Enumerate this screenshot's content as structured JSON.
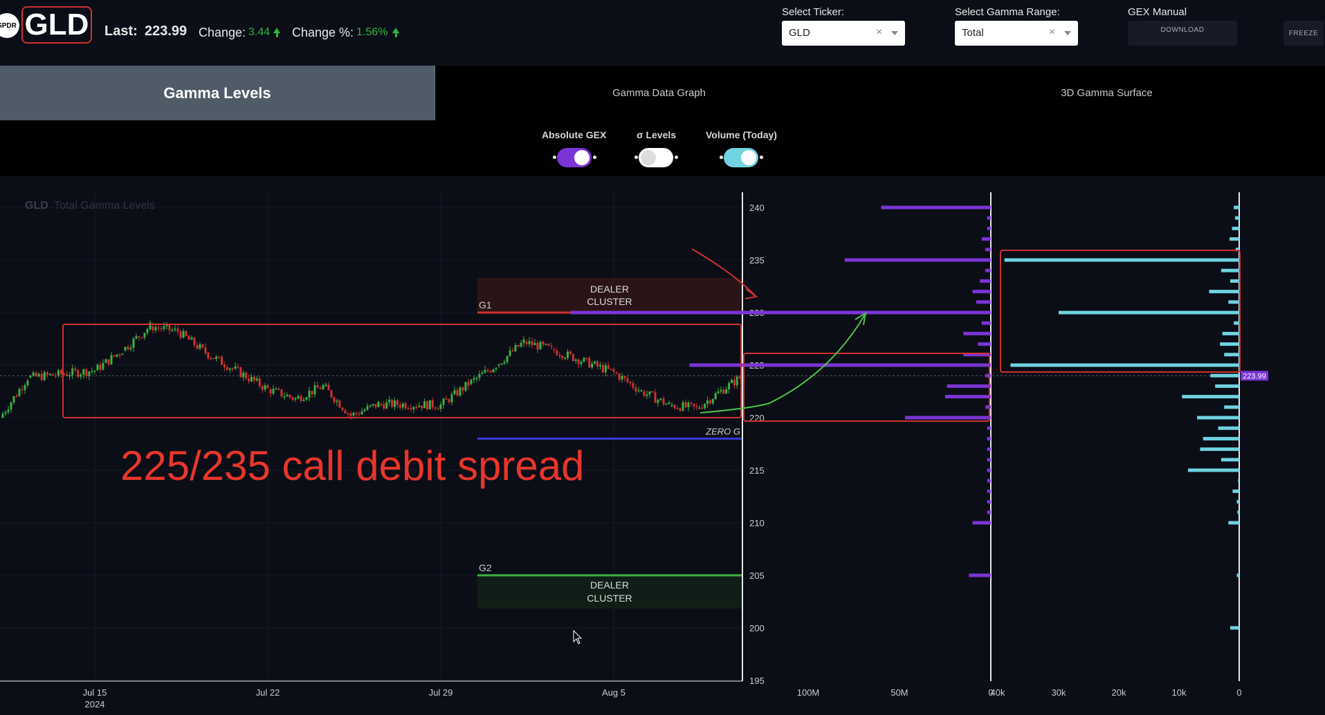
{
  "header": {
    "logo_text": "SPDR",
    "ticker": "GLD",
    "last_label": "Last:",
    "last_value": "223.99",
    "change_label": "Change:",
    "change_value": "3.44",
    "change_pct_label": "Change %:",
    "change_pct_value": "1.56%",
    "positive_color": "#2fb63f"
  },
  "controls": {
    "ticker_label": "Select Ticker:",
    "ticker_value": "GLD",
    "range_label": "Select Gamma Range:",
    "range_value": "Total",
    "gex_manual_label": "GEX Manual",
    "download_label": "DOWNLOAD",
    "freeze_label": "FREEZE",
    "clear_icon": "×"
  },
  "tabs": [
    {
      "label": "Gamma Levels",
      "active": true
    },
    {
      "label": "Gamma Data Graph",
      "active": false
    },
    {
      "label": "3D Gamma Surface",
      "active": false
    }
  ],
  "toggles": [
    {
      "label": "Absolute GEX",
      "on": true,
      "color": "#7b35d6"
    },
    {
      "label": "σ Levels",
      "on": false,
      "color": "#ffffff"
    },
    {
      "label": "Volume (Today)",
      "on": true,
      "color": "#6fd3e0"
    }
  ],
  "chart": {
    "title_ticker": "GLD",
    "title_rest": "Total Gamma Levels",
    "y_ticks": [
      "240",
      "235",
      "230",
      "225",
      "220",
      "215",
      "210",
      "205",
      "200",
      "195"
    ],
    "x_ticks": [
      {
        "label": "Jul 15",
        "sub": "2024"
      },
      {
        "label": "Jul 22",
        "sub": ""
      },
      {
        "label": "Jul 29",
        "sub": ""
      },
      {
        "label": "Aug 5",
        "sub": ""
      }
    ],
    "gex_ticks": [
      "100M",
      "50M",
      "0"
    ],
    "vol_ticks": [
      "40k",
      "30k",
      "20k",
      "10k",
      "0"
    ],
    "g1_label": "G1",
    "g2_label": "G2",
    "dealer_cluster_line1": "DEALER",
    "dealer_cluster_line2": "CLUSTER",
    "zero_g_label": "ZERO G",
    "price_tag": "223.99",
    "annotation": "225/235 call debit spread",
    "levels": {
      "g1": 230,
      "g2": 205,
      "zero_g": 218,
      "last": 223.99
    },
    "colors": {
      "gex": "#7b35d6",
      "volume": "#6fd3e0",
      "g1": "#d0322e",
      "g2": "#3cb043",
      "zero_g": "#3a3ad8",
      "annotation": "#e8362b",
      "up": "#3cb043",
      "down": "#d0322e"
    }
  },
  "chart_data": [
    {
      "type": "bar",
      "name": "Absolute GEX by strike",
      "orientation": "horizontal",
      "categories": [
        240,
        239,
        238,
        237,
        236,
        235,
        234,
        233,
        232,
        231,
        230,
        229,
        228,
        227,
        226,
        225,
        224,
        223,
        222,
        221,
        220,
        219,
        218,
        217,
        216,
        215,
        214,
        213,
        212,
        211,
        210,
        205
      ],
      "values": [
        60,
        2,
        2,
        5,
        3,
        80,
        3,
        6,
        10,
        8,
        230,
        5,
        15,
        7,
        15,
        165,
        3,
        24,
        25,
        3,
        47,
        2,
        2,
        2,
        2,
        2,
        2,
        2,
        2,
        2,
        10,
        12
      ],
      "units": "M",
      "xlim": [
        0,
        135
      ]
    },
    {
      "type": "bar",
      "name": "Volume (Today) by strike",
      "orientation": "horizontal",
      "categories": [
        240,
        239,
        238,
        237,
        236,
        235,
        234,
        233,
        232,
        231,
        230,
        229,
        228,
        227,
        226,
        225,
        224,
        223,
        222,
        221,
        220,
        219,
        218,
        217,
        216,
        215,
        214,
        213,
        212,
        211,
        210,
        205,
        200
      ],
      "values": [
        900,
        700,
        1200,
        1600,
        600,
        39000,
        3000,
        1500,
        5000,
        1800,
        30000,
        900,
        2800,
        3200,
        2500,
        38000,
        4800,
        4000,
        9500,
        2500,
        7000,
        3500,
        6000,
        6500,
        3000,
        8500,
        200,
        1100,
        400,
        300,
        1800,
        400,
        1500
      ],
      "xlim": [
        0,
        41000
      ]
    },
    {
      "type": "line",
      "name": "GLD price",
      "x": [
        "Jul 11",
        "Jul 12",
        "Jul 15",
        "Jul 16",
        "Jul 17",
        "Jul 18",
        "Jul 19",
        "Jul 22",
        "Jul 23",
        "Jul 24",
        "Jul 25",
        "Jul 26",
        "Jul 29",
        "Jul 30",
        "Jul 31",
        "Aug 1",
        "Aug 2",
        "Aug 5",
        "Aug 6",
        "Aug 7",
        "Aug 8",
        "Aug 9"
      ],
      "y": [
        220.0,
        223.8,
        224.5,
        226.4,
        228.7,
        228.2,
        226.2,
        222.7,
        221.8,
        223.0,
        220.2,
        221.3,
        221.2,
        223.2,
        225.0,
        227.2,
        226.5,
        224.3,
        222.5,
        221.2,
        220.9,
        223.99
      ],
      "ylim": [
        195,
        241
      ]
    }
  ]
}
